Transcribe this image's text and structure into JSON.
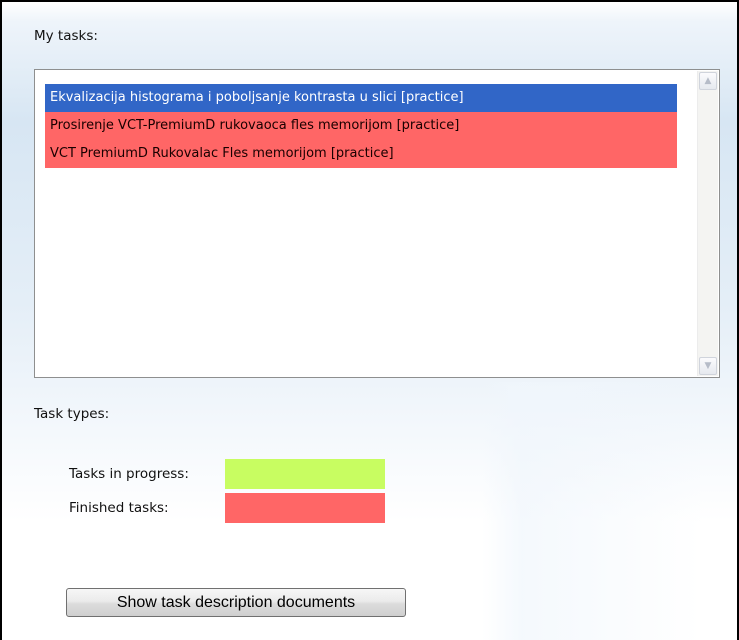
{
  "page": {
    "title": "My tasks:"
  },
  "task_list": {
    "items": [
      {
        "label": "Ekvalizacija histograma i poboljsanje kontrasta u slici [practice]",
        "status": "selected"
      },
      {
        "label": "Prosirenje VCT-PremiumD rukovaoca fles memorijom [practice]",
        "status": "finished"
      },
      {
        "label": "VCT PremiumD Rukovalac Fles memorijom [practice]",
        "status": "finished"
      }
    ],
    "scroll_up_icon": "▲",
    "scroll_down_icon": "▼"
  },
  "task_types": {
    "title": "Task types:",
    "in_progress_label": "Tasks in progress:",
    "in_progress_color": "#c8fd61",
    "finished_label": "Finished tasks:",
    "finished_color": "#ff6666",
    "selection_color": "#3166c7"
  },
  "actions": {
    "show_docs_label": "Show task description documents"
  }
}
